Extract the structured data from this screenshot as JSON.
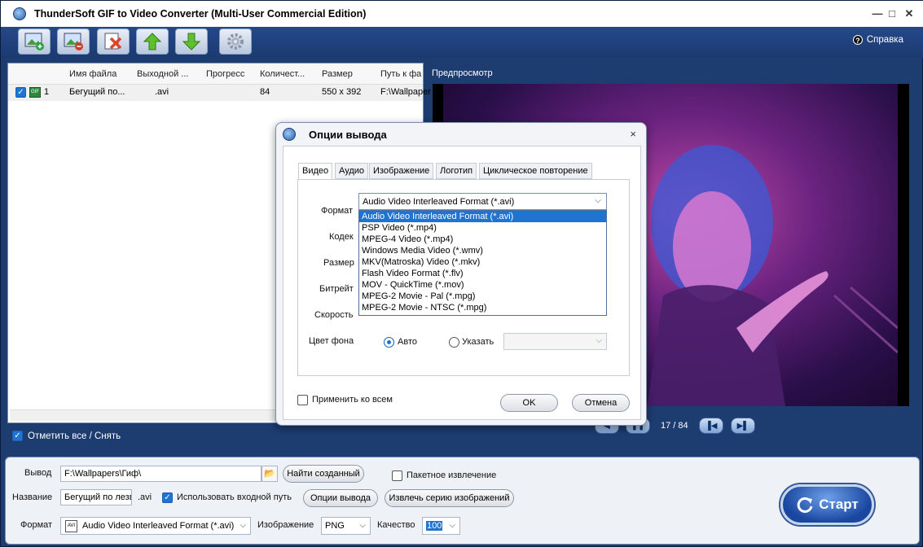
{
  "window": {
    "title": "ThunderSoft GIF to Video Converter (Multi-User Commercial Edition)",
    "minimize": "—",
    "maximize": "□",
    "close": "✕"
  },
  "toolbar": {
    "help_label": "Справка"
  },
  "list": {
    "headers": [
      "Имя файла",
      "Выходной ...",
      "Прогресс",
      "Количест...",
      "Размер",
      "Путь к фа"
    ],
    "rows": [
      {
        "num": "1",
        "name": "Бегущий по...",
        "output": ".avi",
        "progress": "",
        "count": "84",
        "size": "550 x 392",
        "path": "F:\\Wallpaper"
      }
    ],
    "select_all_label": "Отметить все / Снять"
  },
  "preview": {
    "label": "Предпросмотр",
    "frames": "17 / 84"
  },
  "bottom": {
    "output_label": "Вывод",
    "output_path": "F:\\Wallpapers\\Гиф\\",
    "find_button": "Найти созданный",
    "batch_label": "Пакетное извлечение",
    "name_label": "Название",
    "name_value": "Бегущий по лезв",
    "name_ext": ".avi",
    "use_input_label": "Использовать входной путь",
    "options_button": "Опции вывода",
    "extract_button": "Извлечь серию изображений",
    "format_label": "Формат",
    "format_value": "Audio Video Interleaved Format (*.avi)",
    "image_label": "Изображение",
    "image_value": "PNG",
    "quality_label": "Качество",
    "quality_value": "100",
    "start_label": "Старт"
  },
  "dialog": {
    "title": "Опции вывода",
    "close": "×",
    "tabs": [
      "Видео",
      "Аудио",
      "Изображение",
      "Логотип",
      "Циклическое повторение"
    ],
    "format_label": "Формат",
    "format_value": "Audio Video Interleaved Format (*.avi)",
    "codec_label": "Кодек",
    "size_label": "Размер",
    "bitrate_label": "Битрейт",
    "speed_label": "Скорость",
    "bg_label": "Цвет фона",
    "auto_label": "Авто",
    "specify_label": "Указать",
    "apply_all_label": "Применить ко всем",
    "ok_label": "OK",
    "cancel_label": "Отмена",
    "format_options": [
      "Audio Video Interleaved Format (*.avi)",
      "PSP Video (*.mp4)",
      "MPEG-4 Video (*.mp4)",
      "Windows Media Video (*.wmv)",
      "MKV(Matroska) Video (*.mkv)",
      "Flash Video Format (*.flv)",
      "MOV - QuickTime (*.mov)",
      "MPEG-2 Movie - Pal (*.mpg)",
      "MPEG-2 Movie - NTSC (*.mpg)"
    ]
  }
}
